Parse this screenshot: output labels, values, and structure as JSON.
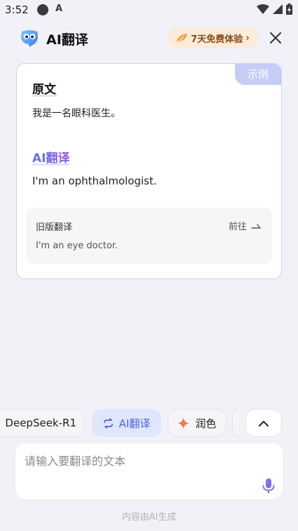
{
  "status_bar": {
    "time": "3:52",
    "a_glyph": "A"
  },
  "header": {
    "title": "AI翻译",
    "trial_label": "7天免费体验",
    "trial_arrow": "›",
    "logo_icon": "owl-logo-icon",
    "close_icon": "close-icon"
  },
  "example": {
    "tag": "示例",
    "source_label": "原文",
    "source_text": "我是一名眼科医生。",
    "ai_label": "AI翻译",
    "target_text": "I'm an ophthalmologist.",
    "old_version": {
      "label": "旧版翻译",
      "goto_label": "前往",
      "text": "I'm an eye doctor."
    }
  },
  "chips": [
    {
      "label": "DeepSeek-R1",
      "active": false
    },
    {
      "label": "AI翻译",
      "active": true,
      "icon": "swap-icon"
    },
    {
      "label": "润色",
      "active": false,
      "icon": "sparkle-icon"
    }
  ],
  "input": {
    "placeholder": "请输入要翻译的文本",
    "value": ""
  },
  "footer_note": "内容由AI生成",
  "colors": {
    "accent": "#4a63e8",
    "ai_gradient_start": "#5b76f3",
    "ai_gradient_end": "#9a55d8",
    "trial_bg": "#fcebd9",
    "trial_text": "#8a4a1a",
    "sparkle": "#f6773f",
    "tag_bg": "#c5cdf7"
  }
}
